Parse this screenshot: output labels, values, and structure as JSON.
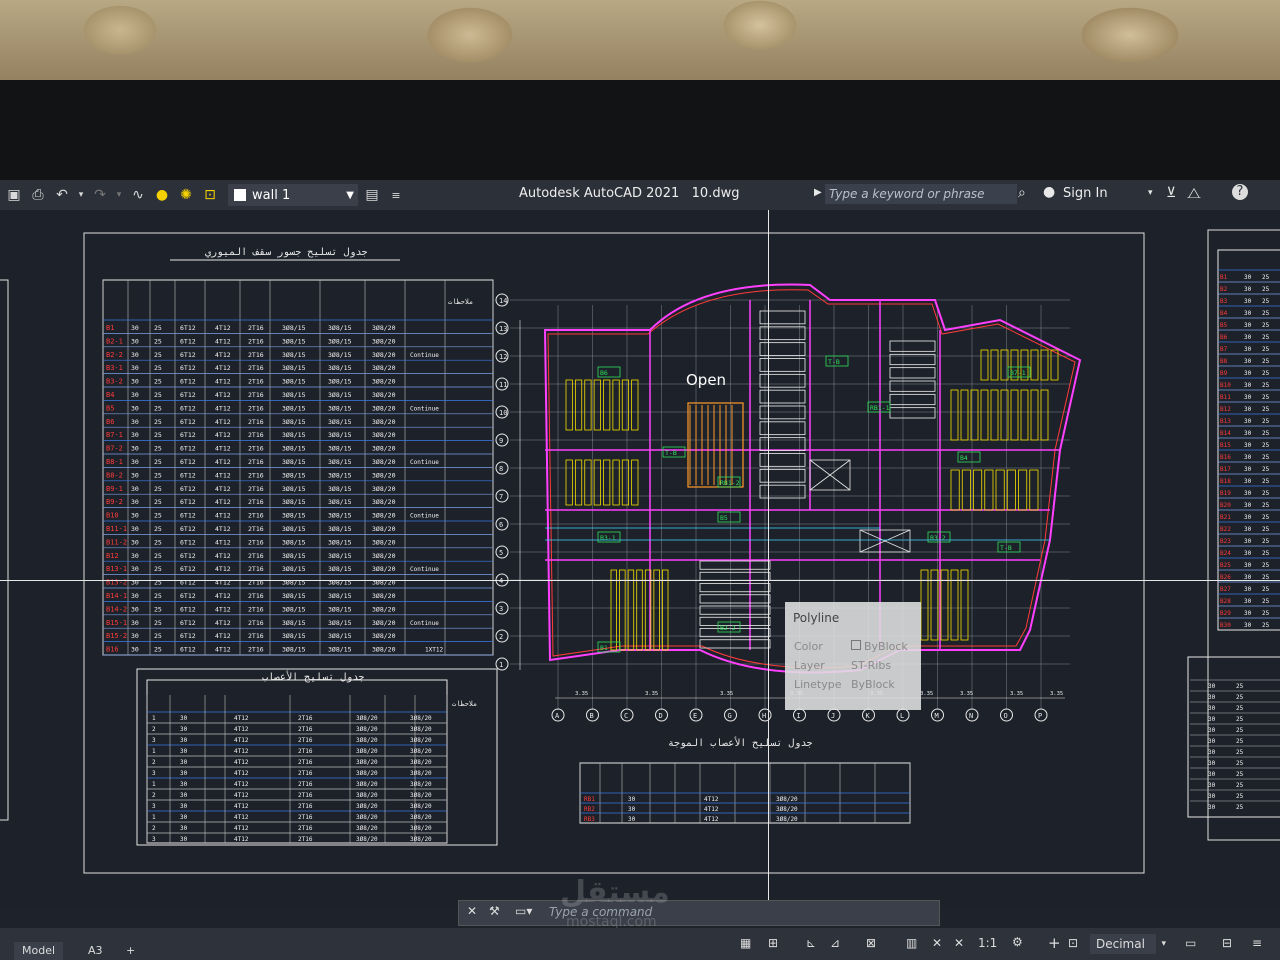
{
  "toolbar": {
    "layer_name": "wall 1",
    "app_title": "Autodesk AutoCAD 2021",
    "file_name": "10.dwg",
    "search_placeholder": "Type a keyword or phrase",
    "sign_in": "Sign In"
  },
  "drawing": {
    "open_label": "Open",
    "table_titles": [
      "جدول تسليح جسور سقف الميوري",
      "جدول تسليح الأعصاب",
      "جدول تسليح الأعصاب الموجة"
    ],
    "notes_header": "ملاحظات",
    "beam_ids": [
      "B1",
      "B2-1",
      "B2-2",
      "B3-1",
      "B3-2",
      "B4",
      "B5",
      "B6",
      "B7-1",
      "B7-2",
      "B8-1",
      "B8-2",
      "B9-1",
      "B9-2",
      "B10",
      "B11-1",
      "B11-2",
      "B12",
      "B13-1",
      "B13-2",
      "B14-1",
      "B14-2",
      "B15-1",
      "B15-2",
      "B16"
    ],
    "cell_samples": [
      "30",
      "25",
      "6T12",
      "4T12",
      "2T16",
      "3Ø8/15",
      "3Ø8/20",
      "Continue",
      "1XT12"
    ]
  },
  "tooltip": {
    "title": "Polyline",
    "rows": [
      {
        "label": "Color",
        "value": "ByBlock"
      },
      {
        "label": "Layer",
        "value": "ST-Ribs"
      },
      {
        "label": "Linetype",
        "value": "ByBlock"
      }
    ]
  },
  "command": {
    "placeholder": "Type a command"
  },
  "status": {
    "tabs": [
      "Model",
      "A3",
      "+"
    ],
    "scale": "1:1",
    "units": "Decimal"
  },
  "watermark": {
    "text": "مستقل",
    "sub": "mostaql.com"
  },
  "colors": {
    "background": "#1d2129",
    "toolbar": "#2c3039",
    "red_text": "#ff3b3b",
    "blue_lines": "#3d7be8",
    "magenta": "#ff40ff",
    "yellow": "#f5e000",
    "green": "#2fe05a",
    "orange": "#ff9a2a"
  }
}
